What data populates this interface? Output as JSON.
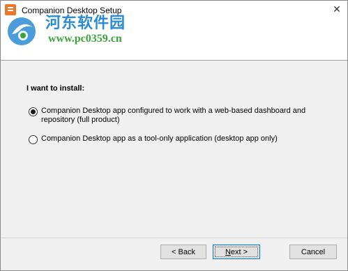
{
  "window": {
    "title": "Companion Desktop Setup",
    "close_glyph": "✕"
  },
  "watermark": {
    "name": "河东软件园",
    "url": "www.pc0359.cn"
  },
  "content": {
    "section_label": "I want to install:",
    "options": [
      {
        "label": "Companion Desktop app configured to work with a web-based dashboard and repository (full product)",
        "selected": true
      },
      {
        "label": "Companion Desktop app as a tool-only application (desktop app only)",
        "selected": false
      }
    ]
  },
  "buttons": {
    "back": "< Back",
    "next_prefix": "",
    "next_mnemonic": "N",
    "next_suffix": "ext >",
    "cancel": "Cancel"
  },
  "colors": {
    "accent": "#0078d7",
    "watermark_blue": "#2a8bd4",
    "watermark_green": "#3aa43a",
    "app_icon": "#e8782c"
  }
}
